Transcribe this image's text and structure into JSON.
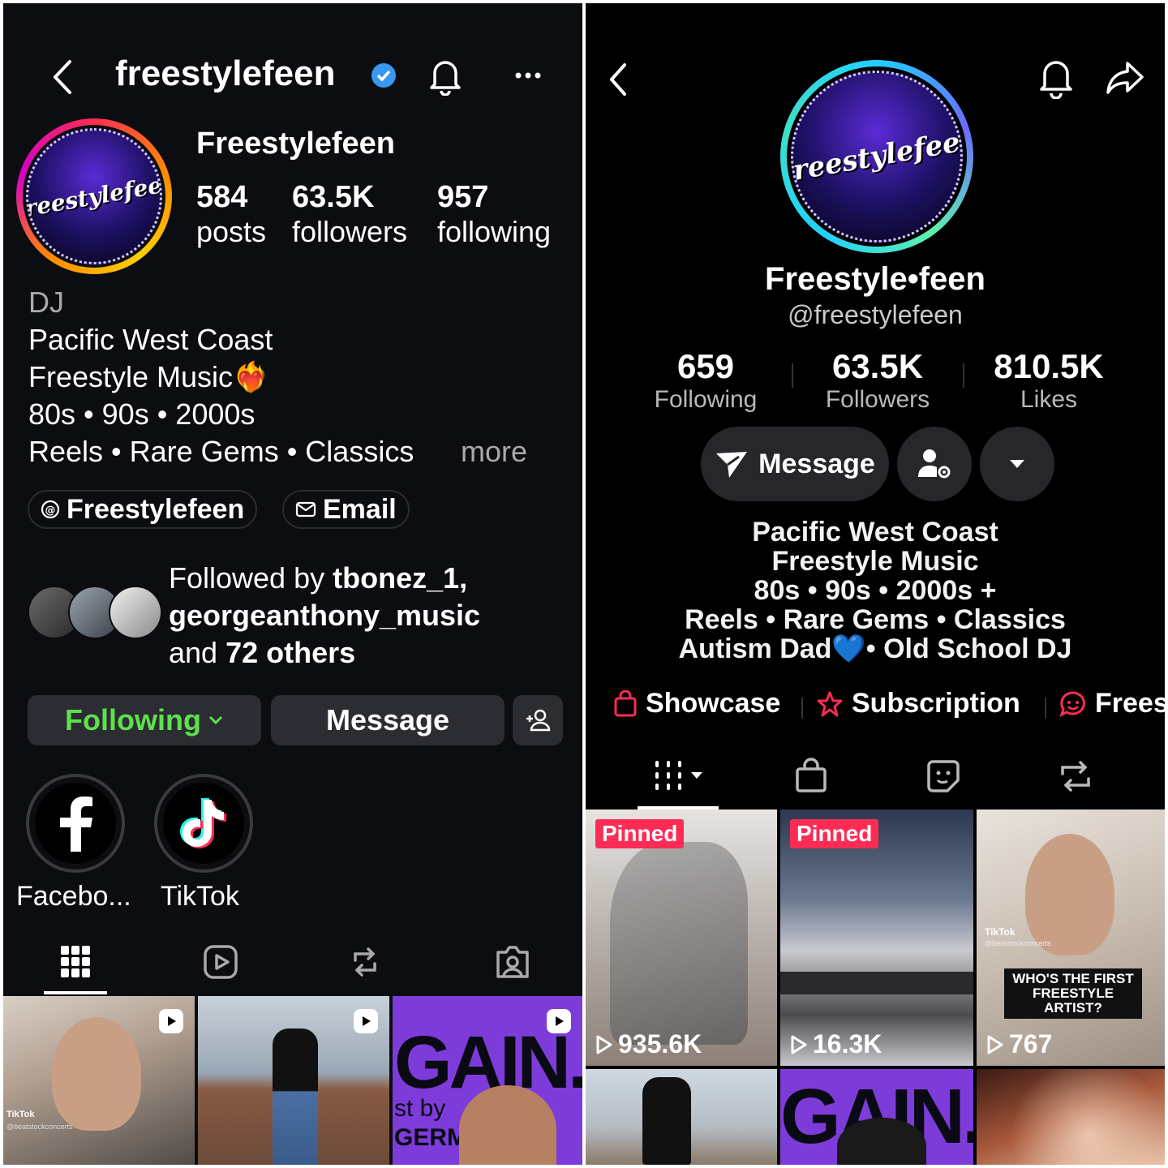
{
  "instagram": {
    "header": {
      "username": "freestylefeen"
    },
    "avatar_text": "Freestylefeen",
    "display_name": "Freestylefeen",
    "stats": [
      {
        "value": "584",
        "label": "posts"
      },
      {
        "value": "63.5K",
        "label": "followers"
      },
      {
        "value": "957",
        "label": "following"
      }
    ],
    "bio": {
      "category": "DJ",
      "lines": [
        "Pacific West Coast",
        "Freestyle Music❤️‍🔥",
        "80s • 90s • 2000s",
        "Reels • Rare Gems • Classics"
      ],
      "more": "more"
    },
    "links": {
      "threads": "Freestylefeen",
      "email": "Email"
    },
    "followed_by": {
      "prefix": "Followed by ",
      "names": "tbonez_1, georgeanthony_music",
      "and": "and ",
      "others": "72 others"
    },
    "buttons": {
      "following": "Following",
      "message": "Message"
    },
    "highlights": [
      {
        "label": "Facebo..."
      },
      {
        "label": "TikTok"
      }
    ],
    "tiles": [
      {
        "watermark": "TikTok",
        "handle": "@beatstockconcerts"
      },
      {},
      {
        "big_text": "GAIN.",
        "small_text": "st by",
        "small_text2": "GERM"
      }
    ]
  },
  "tiktok": {
    "avatar_text": "Freestylefeen",
    "display_name": "Freestyle•feen",
    "handle": "@freestylefeen",
    "stats": [
      {
        "value": "659",
        "label": "Following"
      },
      {
        "value": "63.5K",
        "label": "Followers"
      },
      {
        "value": "810.5K",
        "label": "Likes"
      }
    ],
    "message_button": "Message",
    "bio_lines": [
      "Pacific West Coast",
      "Freestyle Music",
      "80s • 90s • 2000s +",
      "Reels • Rare Gems • Classics",
      "Autism Dad💙• Old School DJ"
    ],
    "links": [
      "Showcase",
      "Subscription",
      "Frees"
    ],
    "tiles": [
      {
        "pinned": "Pinned",
        "views": "935.6K"
      },
      {
        "pinned": "Pinned",
        "views": "16.3K"
      },
      {
        "views": "767",
        "caption": "WHO'S THE FIRST FREESTYLE ARTIST?",
        "watermark": "TikTok",
        "handle": "@beatstockconcerts"
      },
      {},
      {
        "big_text": "GAIN."
      },
      {}
    ],
    "accent_color": "#fe2c55"
  },
  "colors": {
    "ig_following_green": "#5ee04d",
    "verified_blue": "#3897f0"
  }
}
